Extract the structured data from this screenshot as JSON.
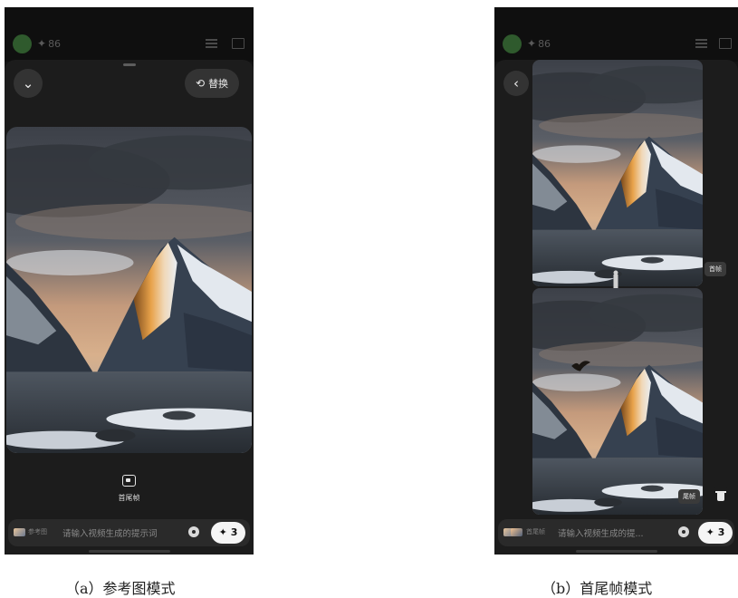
{
  "phone_a": {
    "credits": "86",
    "replace_button": "替换",
    "mode_label": "首尾帧",
    "input": {
      "thumb_label": "参考图",
      "placeholder": "请输入视频生成的提示词",
      "generate_count": "3"
    }
  },
  "phone_b": {
    "credits": "86",
    "first_frame_tag": "首帧",
    "last_frame_tag": "尾帧",
    "input": {
      "thumb_label": "首尾帧",
      "placeholder": "请输入视频生成的提...",
      "generate_count": "3"
    }
  },
  "captions": {
    "a": "（a）参考图模式",
    "b": "（b）首尾帧模式"
  },
  "colors": {
    "app_background": "#141414",
    "sheet_background": "#1c1c1c",
    "button_background": "#333333",
    "generate_button": "#f5f5f5",
    "avatar": "#2f5a2d"
  },
  "icons": [
    "chevron-down-icon",
    "swap-icon",
    "star-icon",
    "list-icon",
    "folder-icon",
    "back-chevron-icon",
    "frames-icon",
    "settings-icon",
    "trash-icon",
    "down-arrow-icon"
  ]
}
